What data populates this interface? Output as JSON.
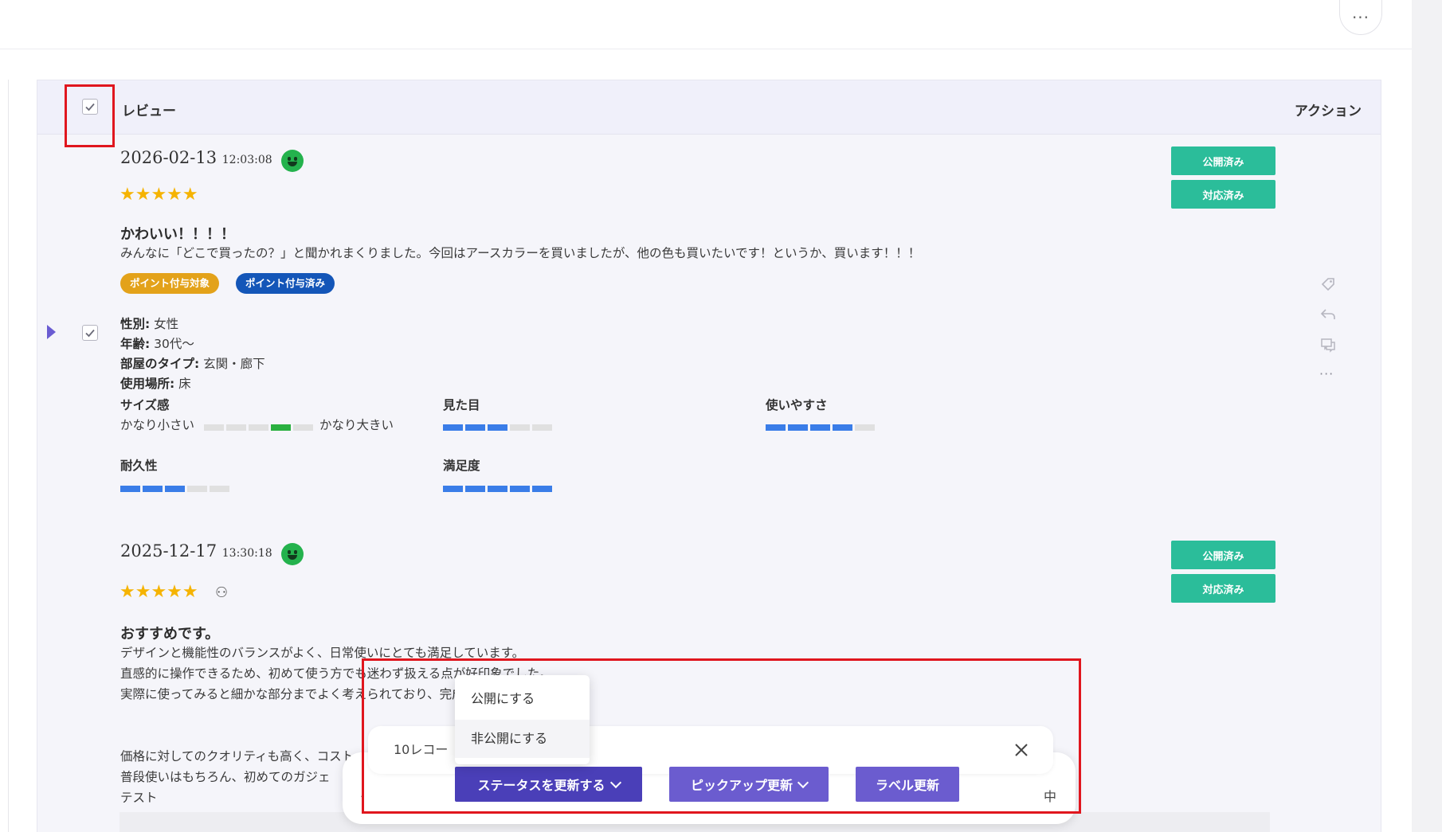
{
  "header": {
    "more_icon": "ellipsis-icon",
    "more_label": "···"
  },
  "table": {
    "col_review": "レビュー",
    "col_action": "アクション"
  },
  "reviews": [
    {
      "date": "2026-02-13",
      "time": "12:03:08",
      "stars": "★★★★★",
      "rating": 5,
      "sentiment_icon": "smile-icon",
      "title": "かわいい！！！！",
      "body": "みんなに「どこで買ったの？」と聞かれまくりました。今回はアースカラーを買いましたが、他の色も買いたいです！というか、買います！！！",
      "badges": [
        {
          "label": "ポイント付与対象",
          "color": "#e3a21a"
        },
        {
          "label": "ポイント付与済み",
          "color": "#1456b8"
        }
      ],
      "meta": [
        {
          "key": "性別:",
          "value": " 女性"
        },
        {
          "key": "年齢:",
          "value": " 30代〜"
        },
        {
          "key": "部屋のタイプ:",
          "value": " 玄関・廊下"
        },
        {
          "key": "使用場所:",
          "value": " 床"
        }
      ],
      "metrics": {
        "size": {
          "label": "サイズ感",
          "low": "かなり小さい",
          "high": "かなり大きい",
          "value": 4,
          "max": 5
        },
        "appearance": {
          "label": "見た目",
          "value": 3,
          "max": 5
        },
        "usability": {
          "label": "使いやすさ",
          "value": 4,
          "max": 5
        },
        "durability": {
          "label": "耐久性",
          "value": 3,
          "max": 5
        },
        "satisfaction": {
          "label": "満足度",
          "value": 5,
          "max": 5
        }
      },
      "status_buttons": [
        "公開済み",
        "対応済み"
      ]
    },
    {
      "date": "2025-12-17",
      "time": "13:30:18",
      "stars": "★★★★★",
      "rating": 5,
      "sentiment_icon": "smile-icon",
      "award_icon": "award-icon",
      "award_glyph": "⚇",
      "title": "おすすめです。",
      "body_lines": [
        "デザインと機能性のバランスがよく、日常使いにとても満足しています。",
        "直感的に操作できるため、初めて使う方でも迷わず扱える点が好印象でした。",
        "実際に使ってみると細かな部分までよく考えられており、完成度の高さを感じます。",
        "",
        "",
        "価格に対してのクオリティも高く、コスト",
        "普段使いはもちろん、初めてのガジェ",
        "テスト"
      ],
      "status_buttons": [
        "公開済み",
        "対応済み"
      ]
    }
  ],
  "side_icons": [
    "tag-icon",
    "reply-icon",
    "comment-icon",
    "more-icon"
  ],
  "side_more_label": "···",
  "bulk_bar": {
    "count_text": "10レコー",
    "right_text": "中",
    "left_glyph": "‹",
    "buttons": [
      {
        "label": "ステータスを更新する",
        "has_chevron": true
      },
      {
        "label": "ピックアップ更新",
        "has_chevron": true
      },
      {
        "label": "ラベル更新",
        "has_chevron": false
      }
    ]
  },
  "status_dropdown": {
    "options": [
      "公開にする",
      "非公開にする"
    ],
    "hovered": "非公開にする"
  },
  "highlight_color": "#e0161e"
}
